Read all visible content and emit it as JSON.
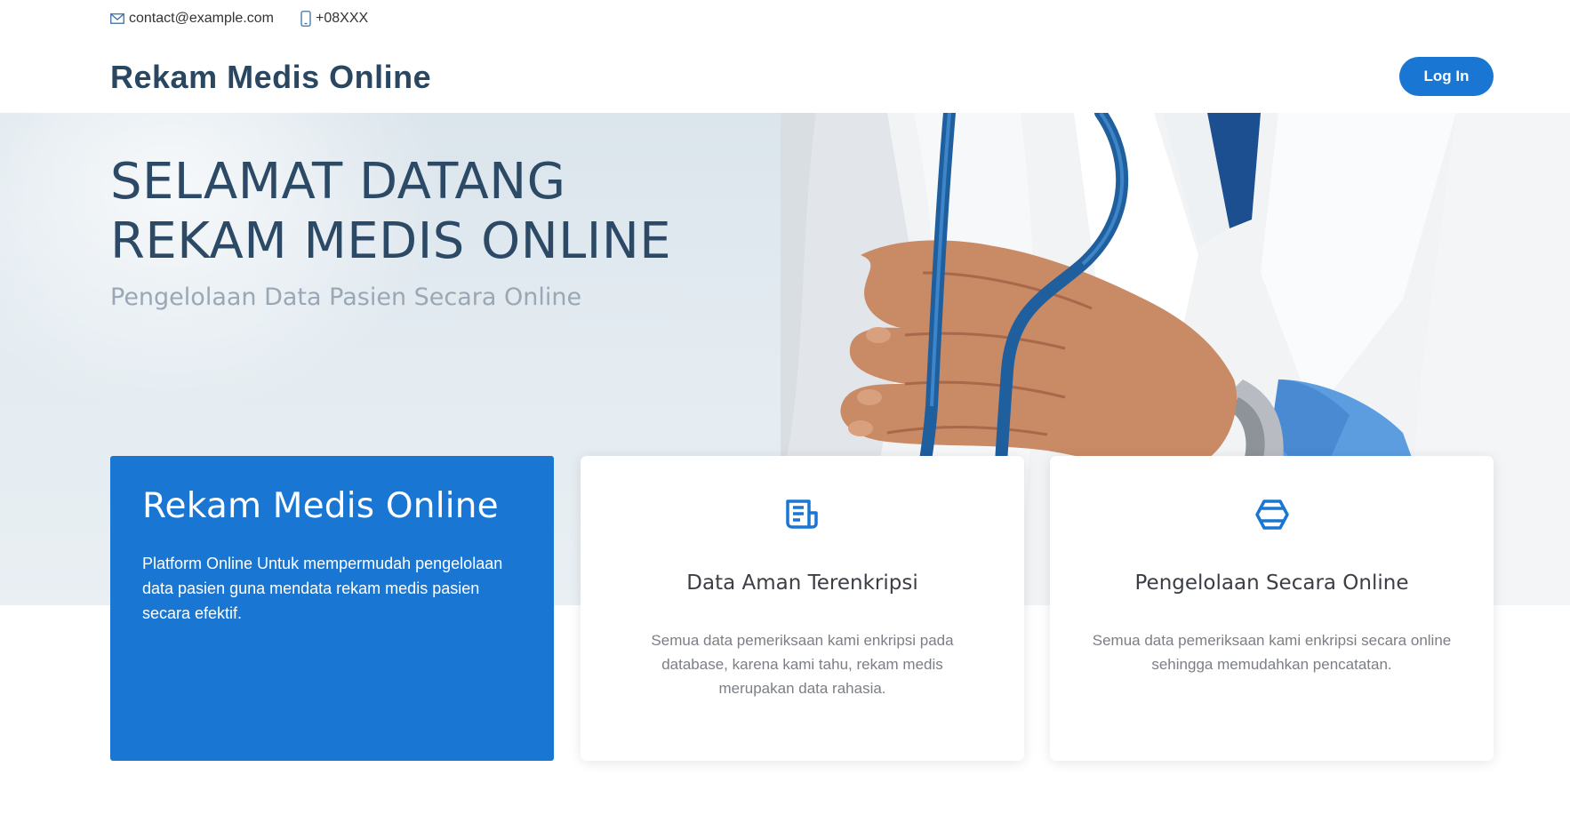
{
  "topbar": {
    "email": "contact@example.com",
    "phone": "+08XXX",
    "email_icon": "envelope-icon",
    "phone_icon": "mobile-phone-icon"
  },
  "header": {
    "brand": "Rekam Medis Online",
    "login_label": "Log In"
  },
  "hero": {
    "title_line1": "SELAMAT DATANG",
    "title_line2": "REKAM MEDIS ONLINE",
    "subtitle": "Pengelolaan Data Pasien Secara Online"
  },
  "intro_card": {
    "title": "Rekam Medis Online",
    "text": "Platform Online Untuk mempermudah pengelolaan data pasien guna mendata rekam medis pasien secara efektif."
  },
  "features": [
    {
      "icon": "document-icon",
      "title": "Data Aman Terenkripsi",
      "description": "Semua data pemeriksaan kami enkripsi pada database, karena kami tahu, rekam medis merupakan data rahasia."
    },
    {
      "icon": "hexagon-cube-icon",
      "title": "Pengelolaan Secara Online",
      "description": "Semua data pemeriksaan kami enkripsi secara online sehingga memudahkan pencatatan."
    }
  ],
  "colors": {
    "primary": "#1976d2",
    "brand_text": "#2a4762",
    "hero_text": "#2c4a66",
    "stethoscope": "#1f5f9e"
  }
}
